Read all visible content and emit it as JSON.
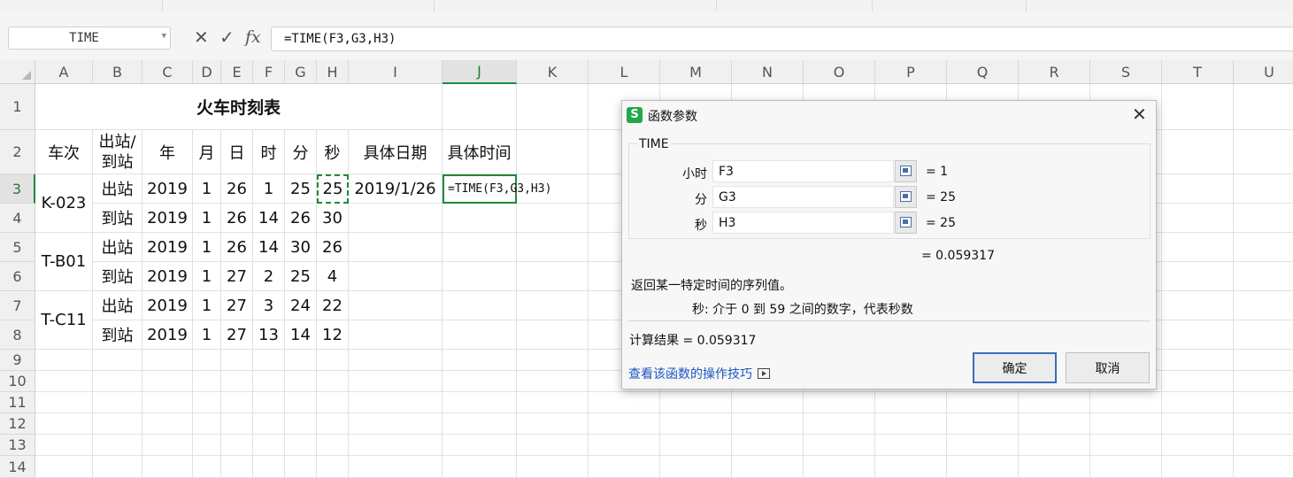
{
  "formula_bar": {
    "name_box": "TIME",
    "cancel_glyph": "✕",
    "confirm_glyph": "✓",
    "fx_label": "fx",
    "formula": "=TIME(F3,G3,H3)"
  },
  "columns": [
    "A",
    "B",
    "C",
    "D",
    "E",
    "F",
    "G",
    "H",
    "I",
    "J",
    "K",
    "L",
    "M",
    "N",
    "O",
    "P",
    "Q",
    "R",
    "S",
    "T",
    "U"
  ],
  "rows": [
    "1",
    "2",
    "3",
    "4",
    "5",
    "6",
    "7",
    "8",
    "9",
    "10",
    "11",
    "12",
    "13",
    "14"
  ],
  "sheet": {
    "title": "火车时刻表",
    "headers": {
      "train": "车次",
      "dir_line1": "出站/",
      "dir_line2": "到站",
      "year": "年",
      "month": "月",
      "day": "日",
      "hour": "时",
      "minute": "分",
      "second": "秒",
      "date": "具体日期",
      "time": "具体时间"
    },
    "trains": [
      "K-023",
      "T-B01",
      "T-C11"
    ],
    "records": [
      {
        "dir": "出站",
        "y": "2019",
        "m": "1",
        "d": "26",
        "h": "1",
        "mi": "25",
        "s": "25",
        "date": "2019/1/26",
        "time": "=TIME(F3,G3,H3)"
      },
      {
        "dir": "到站",
        "y": "2019",
        "m": "1",
        "d": "26",
        "h": "14",
        "mi": "26",
        "s": "30"
      },
      {
        "dir": "出站",
        "y": "2019",
        "m": "1",
        "d": "26",
        "h": "14",
        "mi": "30",
        "s": "26"
      },
      {
        "dir": "到站",
        "y": "2019",
        "m": "1",
        "d": "27",
        "h": "2",
        "mi": "25",
        "s": "4"
      },
      {
        "dir": "出站",
        "y": "2019",
        "m": "1",
        "d": "27",
        "h": "3",
        "mi": "24",
        "s": "22"
      },
      {
        "dir": "到站",
        "y": "2019",
        "m": "1",
        "d": "27",
        "h": "13",
        "mi": "14",
        "s": "12"
      }
    ]
  },
  "dialog": {
    "logo": "S",
    "title": "函数参数",
    "close_glyph": "✕",
    "function_name": "TIME",
    "params": [
      {
        "label": "小时",
        "value": "F3",
        "result": "= 1"
      },
      {
        "label": "分",
        "value": "G3",
        "result": "= 25"
      },
      {
        "label": "秒",
        "value": "H3",
        "result": "= 25"
      }
    ],
    "formula_result": "= 0.059317",
    "description": "返回某一特定时间的序列值。",
    "param_description": "秒:  介于 0 到 59 之间的数字，代表秒数",
    "calc_result": "计算结果 = 0.059317",
    "help_link": "查看该函数的操作技巧",
    "ok_label": "确定",
    "cancel_label": "取消"
  },
  "colors": {
    "selection_green": "#1e8a3a",
    "header_bg": "#f0f0f0",
    "link_blue": "#1b55c4",
    "ok_border": "#3a6dbf"
  }
}
